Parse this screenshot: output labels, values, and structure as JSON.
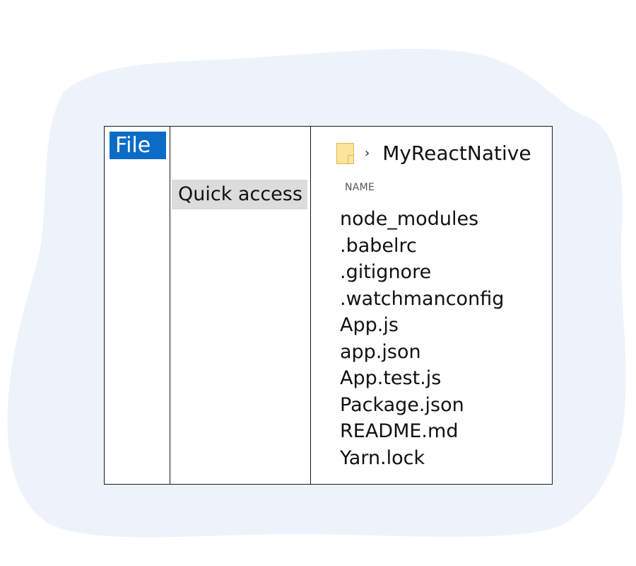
{
  "menu": {
    "file_label": "File"
  },
  "nav": {
    "quick_access_label": "Quick access"
  },
  "breadcrumb": {
    "folder_icon": "folder-icon",
    "separator": "›",
    "folder_name": "MyReactNative"
  },
  "file_list": {
    "column_header": "NAME",
    "items": [
      "node_modules",
      ".babelrc",
      ".gitignore",
      ".watchmanconfig",
      "App.js",
      "app.json",
      "App.test.js",
      "Package.json",
      "README.md",
      "Yarn.lock"
    ]
  },
  "colors": {
    "file_tab": "#0a6cc6",
    "quick_access_bg": "#dcdcdc",
    "backdrop": "#eef3fb",
    "folder": "#fce49a"
  }
}
